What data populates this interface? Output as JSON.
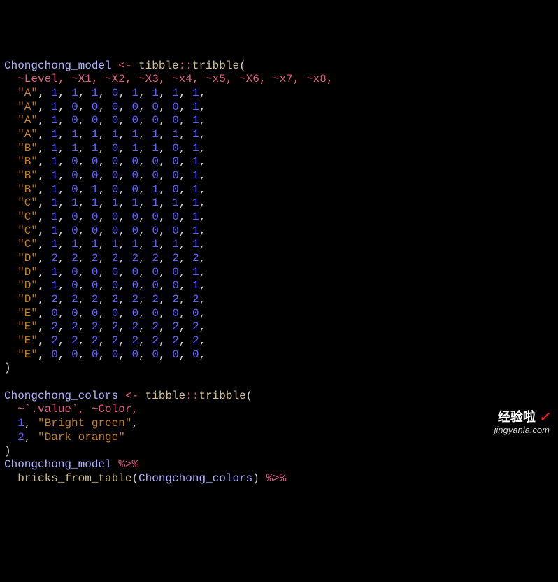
{
  "line1": {
    "obj": "Chongchong_model",
    "assign": " <- ",
    "pkg": "tibble",
    "dcolon": "::",
    "fn": "tribble",
    "open": "("
  },
  "line2": "  ~Level, ~X1, ~X2, ~X3, ~x4, ~x5, ~X6, ~x7, ~x8,",
  "rows": [
    {
      "lvl": "\"A\"",
      "v": [
        1,
        1,
        1,
        0,
        1,
        1,
        1,
        1
      ]
    },
    {
      "lvl": "\"A\"",
      "v": [
        1,
        0,
        0,
        0,
        0,
        0,
        0,
        1
      ]
    },
    {
      "lvl": "\"A\"",
      "v": [
        1,
        0,
        0,
        0,
        0,
        0,
        0,
        1
      ]
    },
    {
      "lvl": "\"A\"",
      "v": [
        1,
        1,
        1,
        1,
        1,
        1,
        1,
        1
      ]
    },
    {
      "lvl": "\"B\"",
      "v": [
        1,
        1,
        1,
        0,
        1,
        1,
        0,
        1
      ]
    },
    {
      "lvl": "\"B\"",
      "v": [
        1,
        0,
        0,
        0,
        0,
        0,
        0,
        1
      ]
    },
    {
      "lvl": "\"B\"",
      "v": [
        1,
        0,
        0,
        0,
        0,
        0,
        0,
        1
      ]
    },
    {
      "lvl": "\"B\"",
      "v": [
        1,
        0,
        1,
        0,
        0,
        1,
        0,
        1
      ]
    },
    {
      "lvl": "\"C\"",
      "v": [
        1,
        1,
        1,
        1,
        1,
        1,
        1,
        1
      ]
    },
    {
      "lvl": "\"C\"",
      "v": [
        1,
        0,
        0,
        0,
        0,
        0,
        0,
        1
      ]
    },
    {
      "lvl": "\"C\"",
      "v": [
        1,
        0,
        0,
        0,
        0,
        0,
        0,
        1
      ]
    },
    {
      "lvl": "\"C\"",
      "v": [
        1,
        1,
        1,
        1,
        1,
        1,
        1,
        1
      ]
    },
    {
      "lvl": "\"D\"",
      "v": [
        2,
        2,
        2,
        2,
        2,
        2,
        2,
        2
      ]
    },
    {
      "lvl": "\"D\"",
      "v": [
        1,
        0,
        0,
        0,
        0,
        0,
        0,
        1
      ]
    },
    {
      "lvl": "\"D\"",
      "v": [
        1,
        0,
        0,
        0,
        0,
        0,
        0,
        1
      ]
    },
    {
      "lvl": "\"D\"",
      "v": [
        2,
        2,
        2,
        2,
        2,
        2,
        2,
        2
      ]
    },
    {
      "lvl": "\"E\"",
      "v": [
        0,
        0,
        0,
        0,
        0,
        0,
        0,
        0
      ]
    },
    {
      "lvl": "\"E\"",
      "v": [
        2,
        2,
        2,
        2,
        2,
        2,
        2,
        2
      ]
    },
    {
      "lvl": "\"E\"",
      "v": [
        2,
        2,
        2,
        2,
        2,
        2,
        2,
        2
      ]
    },
    {
      "lvl": "\"E\"",
      "v": [
        0,
        0,
        0,
        0,
        0,
        0,
        0,
        0
      ]
    }
  ],
  "close1": ")",
  "blank": "",
  "c1": {
    "obj": "Chongchong_colors",
    "assign": " <- ",
    "pkg": "tibble",
    "dcolon": "::",
    "fn": "tribble",
    "open": "("
  },
  "c2": {
    "head": "  ~`.value`, ~Color,"
  },
  "cr": [
    {
      "n": "1",
      "s": "\"Bright green\""
    },
    {
      "n": "2",
      "s": "\"Dark orange\""
    }
  ],
  "close2": ")",
  "p1": {
    "obj": "Chongchong_model",
    "pipe": " %>%"
  },
  "p2": {
    "indent": "  ",
    "fn": "bricks_from_table",
    "open": "(",
    "arg": "Chongchong_colors",
    "close": ")",
    "pipe": " %>%"
  },
  "watermark": {
    "top": "经验啦",
    "check": "✓",
    "bot": "jingyanla.com"
  }
}
